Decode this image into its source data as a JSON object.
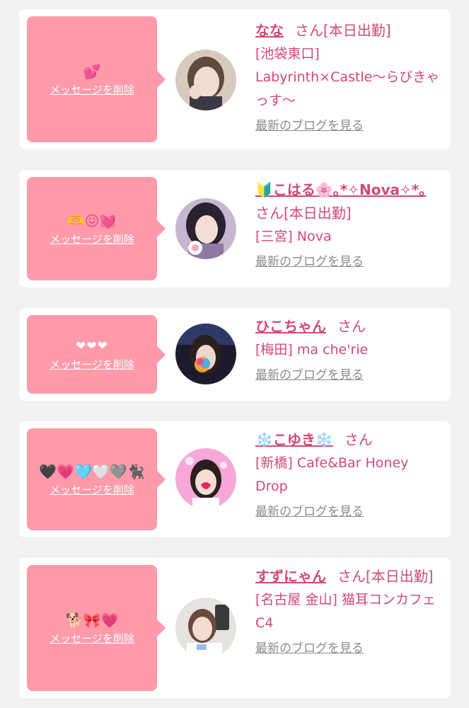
{
  "delete_label": "メッセージを削除",
  "blog_label": "最新のブログを見る",
  "san_label": "さん",
  "cards": [
    {
      "message": "💕",
      "name": "なな",
      "status": "[本日出勤]",
      "shop": "[池袋東口] Labyrinth×Castle〜らびきゃっす〜"
    },
    {
      "message": "🫶😖💓",
      "name": "🔰こはる🌸｡*✧Nova✧*｡",
      "status": "[本日出勤]",
      "shop": "[三宮] Nova"
    },
    {
      "message": "❤❤❤",
      "name": "ひこちゃん",
      "status": "",
      "shop": "[梅田] ma che'rie"
    },
    {
      "message": "🖤💗🩵🤍🩶🐈‍⬛",
      "name": "❄️こゆき❄️",
      "status": "",
      "shop": "[新橋] Cafe&Bar Honey Drop"
    },
    {
      "message": "🐕🎀💗",
      "name": "すずにゃん",
      "status": "[本日出勤]",
      "shop": "[名古屋 金山] 猫耳コンカフェ C4"
    }
  ]
}
